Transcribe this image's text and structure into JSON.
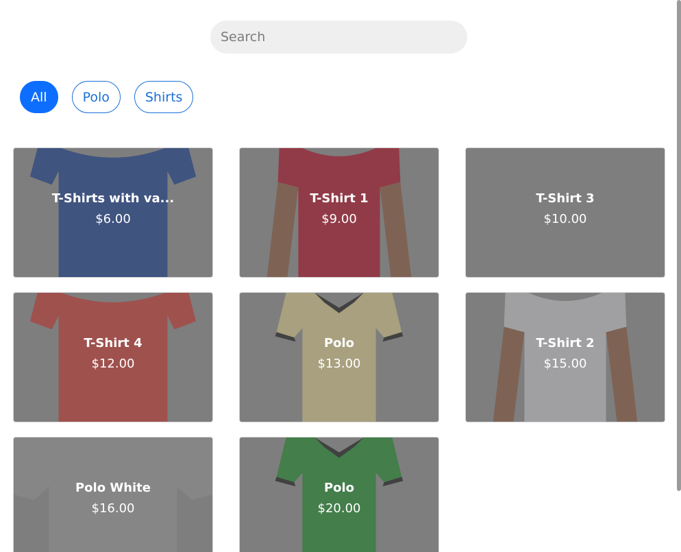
{
  "search": {
    "placeholder": "Search",
    "value": ""
  },
  "filters": [
    {
      "label": "All",
      "active": true
    },
    {
      "label": "Polo",
      "active": false
    },
    {
      "label": "Shirts",
      "active": false
    }
  ],
  "products": [
    {
      "name": "T-Shirts with va...",
      "price": "$6.00",
      "color": "#1a3f8e",
      "style": "flat"
    },
    {
      "name": "T-Shirt 1",
      "price": "$9.00",
      "color": "#b01229",
      "style": "model"
    },
    {
      "name": "T-Shirt 3",
      "price": "$10.00",
      "color": "#8a8a8a",
      "style": "closeup"
    },
    {
      "name": "T-Shirt 4",
      "price": "$12.00",
      "color": "#c73a33",
      "style": "flat"
    },
    {
      "name": "Polo",
      "price": "$13.00",
      "color": "#d8c98a",
      "style": "polo"
    },
    {
      "name": "T-Shirt 2",
      "price": "$15.00",
      "color": "#c8c8cc",
      "style": "model"
    },
    {
      "name": "Polo White",
      "price": "$16.00",
      "color": "#9a9a9a",
      "style": "closeup"
    },
    {
      "name": "Polo",
      "price": "$20.00",
      "color": "#1f8a2e",
      "style": "polo"
    }
  ]
}
